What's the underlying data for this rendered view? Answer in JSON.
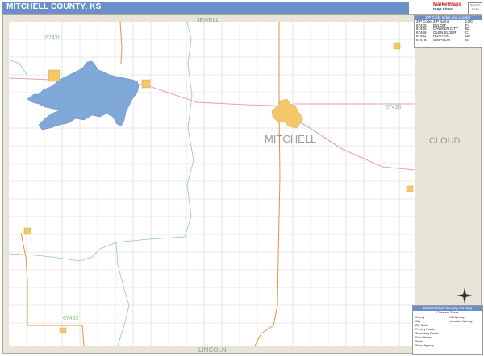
{
  "title": "MITCHELL COUNTY, KS",
  "logo": {
    "line1": "Marketmaps",
    "line2": "map store"
  },
  "badge": "SINCE 1970",
  "labels": {
    "county_main": "MITCHELL",
    "adjacent_north": "JEWELL",
    "adjacent_south": "LINCOLN",
    "adjacent_east": "CLOUD"
  },
  "zip_labels": [
    "67430",
    "67420",
    "67452"
  ],
  "legend": {
    "header": "ZIP Code Index and Locator",
    "columns": [
      "ZIP Code",
      "ZIP Name",
      "LOC"
    ],
    "rows": [
      [
        "67420",
        "BELOIT",
        "F4"
      ],
      [
        "67430",
        "CAWKER CITY",
        "B2"
      ],
      [
        "67446",
        "GLEN ELDER",
        "C1"
      ],
      [
        "67452",
        "HUNTER",
        "D6"
      ],
      [
        "67478",
        "SIMPSON",
        "I4"
      ]
    ]
  },
  "key": {
    "header": "2015 Mitchell County, KS Map",
    "subheader": "Cities and Towns",
    "items": [
      "County",
      "City",
      "ZIP Code",
      "Primary Roads",
      "Secondary Roads",
      "River/Stream",
      "Water",
      "State Highway",
      "US Highway",
      "Interstate Highway"
    ]
  },
  "compass": {
    "n": "N"
  },
  "colors": {
    "title_bar": "#6b8fc9",
    "lake": "#7fa8d8",
    "city": "#f4c869",
    "highway": "#e8a0b4",
    "zip_boundary": "#8fd08f",
    "road": "#cfcfcf",
    "state_road": "#e8923c",
    "outside": "#e8e4d8"
  }
}
